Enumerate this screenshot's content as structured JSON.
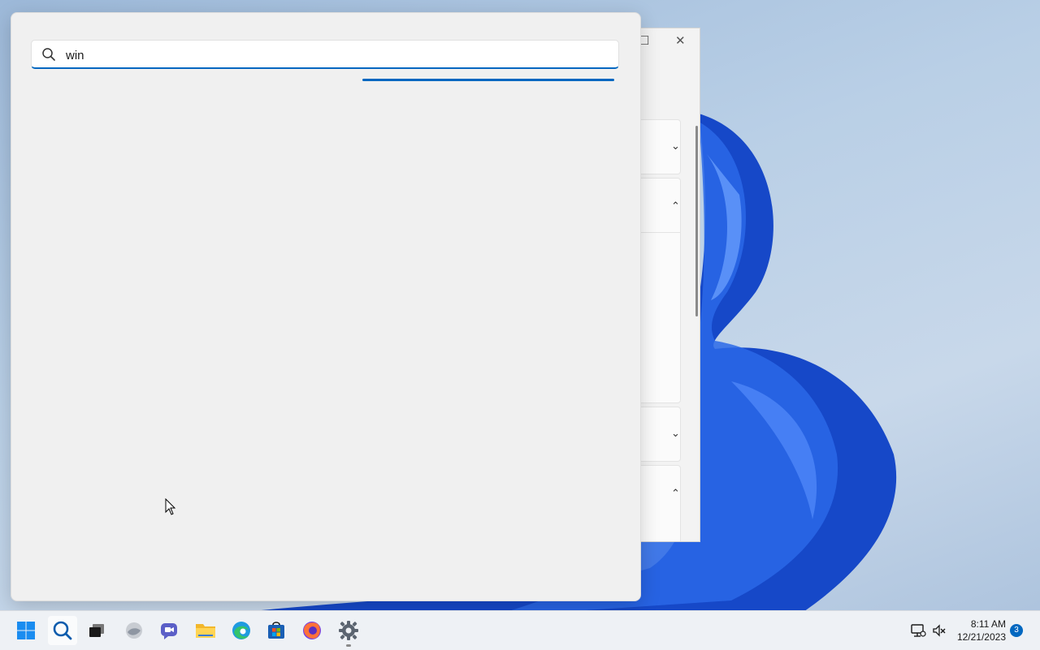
{
  "search": {
    "query": "win",
    "progress_shown": true
  },
  "taskbar": {
    "items": [
      {
        "name": "start",
        "icon": "windows-logo-icon"
      },
      {
        "name": "search",
        "icon": "search-icon",
        "active": true
      },
      {
        "name": "task-view",
        "icon": "task-view-icon"
      },
      {
        "name": "widgets",
        "icon": "widgets-icon"
      },
      {
        "name": "teams-chat",
        "icon": "teams-chat-icon"
      },
      {
        "name": "file-explorer",
        "icon": "folder-icon"
      },
      {
        "name": "edge",
        "icon": "edge-icon"
      },
      {
        "name": "store",
        "icon": "store-icon"
      },
      {
        "name": "firefox",
        "icon": "firefox-icon"
      },
      {
        "name": "settings",
        "icon": "gear-icon",
        "running": true
      }
    ],
    "tray": {
      "network_icon": "network-icon",
      "volume_icon": "volume-muted-icon"
    },
    "clock": {
      "time": "8:11 AM",
      "date": "12/21/2023"
    },
    "notification_count": "3"
  },
  "colors": {
    "accent": "#0067c0",
    "panel": "#f0f0f0",
    "taskbar": "#eef1f5"
  }
}
